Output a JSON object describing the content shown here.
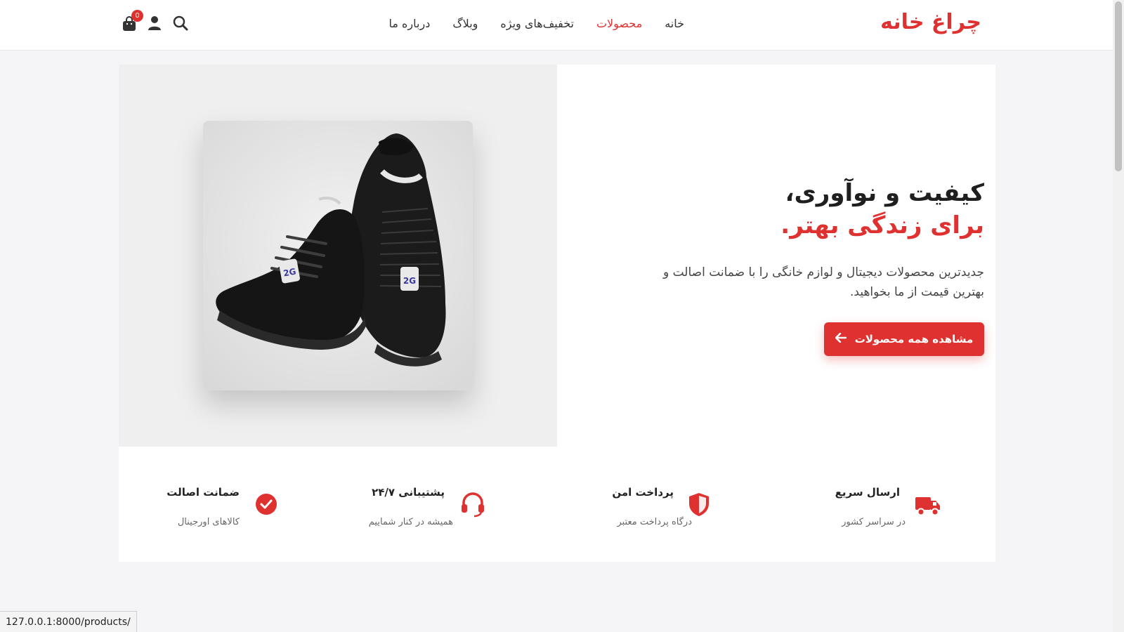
{
  "header": {
    "logo": "چراغ خانه",
    "nav": [
      {
        "label": "خانه"
      },
      {
        "label": "محصولات",
        "active": true
      },
      {
        "label": "تخفیف‌های ویژه"
      },
      {
        "label": "وبلاگ"
      },
      {
        "label": "درباره ما"
      }
    ],
    "cart_count": "0",
    "icons": [
      "search-icon",
      "user-icon",
      "cart-icon"
    ]
  },
  "hero": {
    "title_line1": "کیفیت و نوآوری،",
    "title_line2": "برای زندگی بهتر.",
    "description": "جدیدترین محصولات دیجیتال و لوازم خانگی را با ضمانت اصالت و بهترین قیمت از ما بخواهید.",
    "cta_label": "مشاهده همه محصولات",
    "image": "product-sneaker-black"
  },
  "features": [
    {
      "icon": "truck-icon",
      "title": "ارسال سریع",
      "subtitle": "در سراسر کشور"
    },
    {
      "icon": "shield-icon",
      "title": "پرداخت امن",
      "subtitle": "درگاه پرداخت معتبر"
    },
    {
      "icon": "headset-icon",
      "title": "پشتیبانی ۲۴/۷",
      "subtitle": "همیشه در کنار شماییم"
    },
    {
      "icon": "check-circle-icon",
      "title": "ضمانت اصالت",
      "subtitle": "کالاهای اورجینال"
    }
  ],
  "status_url": "127.0.0.1:8000/products/",
  "colors": {
    "accent": "#e03131",
    "background": "#f5f5f7",
    "surface": "#ffffff"
  }
}
